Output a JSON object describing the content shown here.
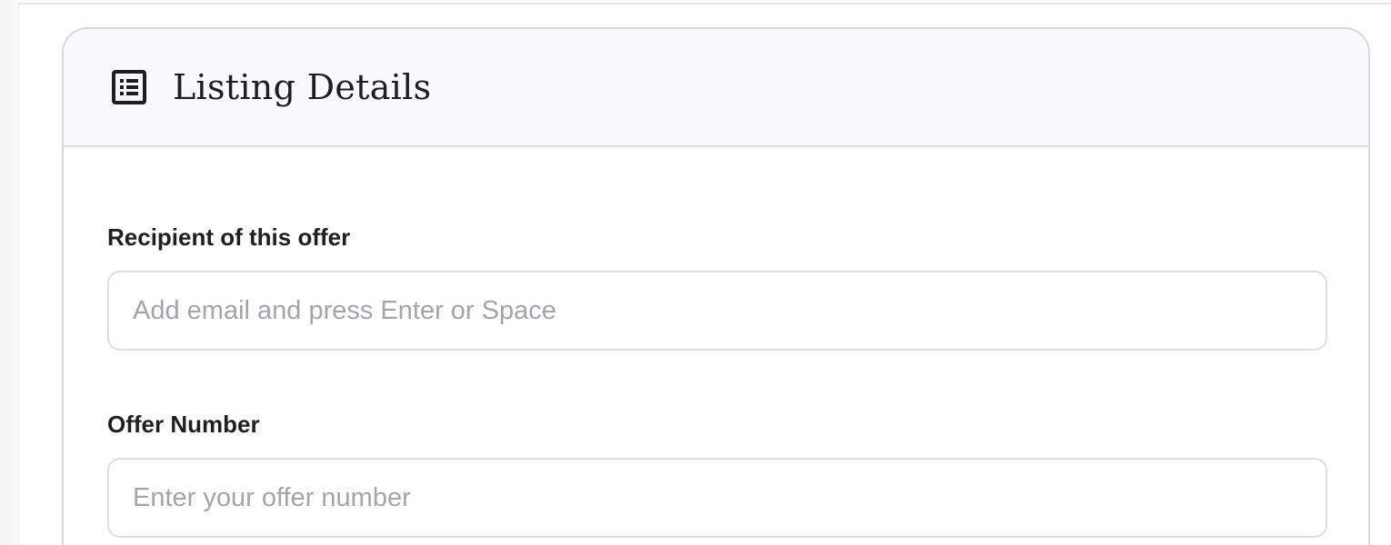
{
  "card": {
    "title": "Listing Details",
    "icon": "list-details-icon"
  },
  "form": {
    "recipient": {
      "label": "Recipient of this offer",
      "placeholder": "Add email and press Enter or Space",
      "value": ""
    },
    "offer_number": {
      "label": "Offer Number",
      "placeholder": "Enter your offer number",
      "value": ""
    }
  },
  "colors": {
    "header_background": "#f8f9fd",
    "border": "#d6d9de",
    "label_text": "#1f2024",
    "placeholder_text": "#a3a5aa"
  }
}
